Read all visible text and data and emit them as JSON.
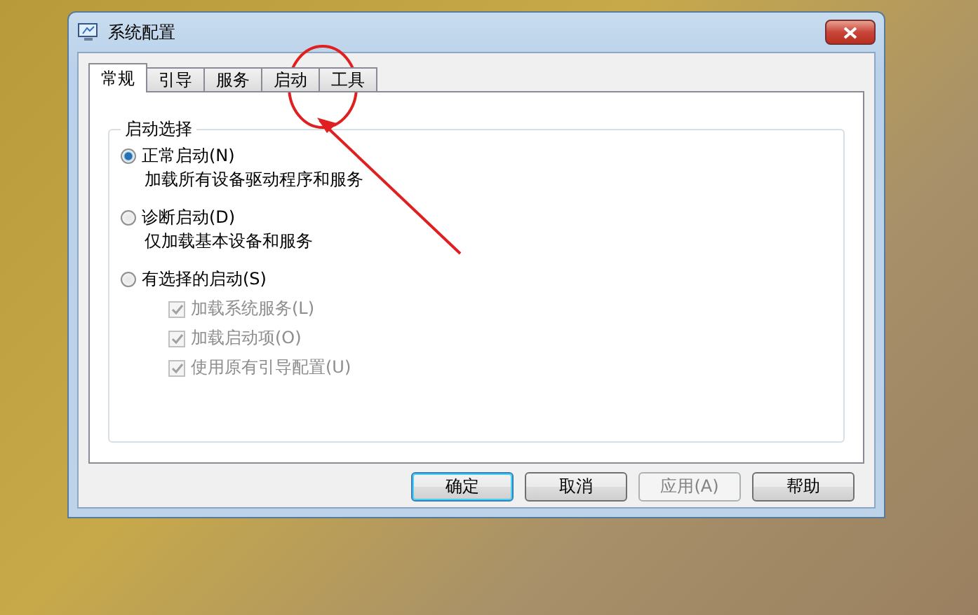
{
  "window": {
    "title": "系统配置"
  },
  "tabs": [
    {
      "label": "常规",
      "selected": true
    },
    {
      "label": "引导",
      "selected": false
    },
    {
      "label": "服务",
      "selected": false
    },
    {
      "label": "启动",
      "selected": false
    },
    {
      "label": "工具",
      "selected": false
    }
  ],
  "group": {
    "title": "启动选择",
    "options": [
      {
        "label": "正常启动(N)",
        "hint": "加载所有设备驱动程序和服务",
        "selected": true
      },
      {
        "label": "诊断启动(D)",
        "hint": "仅加载基本设备和服务",
        "selected": false
      },
      {
        "label": "有选择的启动(S)",
        "selected": false,
        "children": [
          {
            "label": "加载系统服务(L)",
            "checked": true,
            "disabled": true
          },
          {
            "label": "加载启动项(O)",
            "checked": true,
            "disabled": true
          },
          {
            "label": "使用原有引导配置(U)",
            "checked": true,
            "disabled": true
          }
        ]
      }
    ]
  },
  "buttons": [
    {
      "label": "确定",
      "default": true,
      "disabled": false
    },
    {
      "label": "取消",
      "default": false,
      "disabled": false
    },
    {
      "label": "应用(A)",
      "default": false,
      "disabled": true
    },
    {
      "label": "帮助",
      "default": false,
      "disabled": false
    }
  ]
}
